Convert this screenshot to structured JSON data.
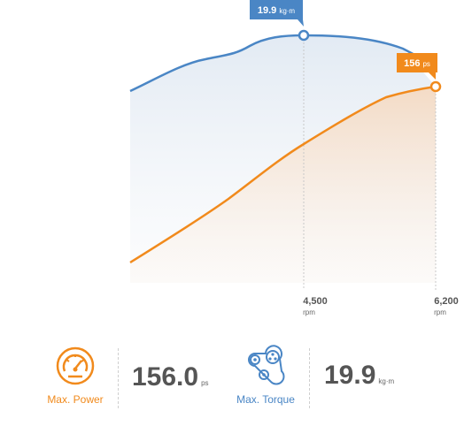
{
  "colors": {
    "power": "#f18a1c",
    "torque": "#4a86c5",
    "text": "#555555"
  },
  "chart_data": {
    "type": "line",
    "x_ticks": [
      {
        "value": "4,500",
        "unit": "rpm"
      },
      {
        "value": "6,200",
        "unit": "rpm"
      }
    ],
    "series": [
      {
        "key": "torque",
        "peak_label_value": "19.9",
        "peak_label_unit": "kg·m",
        "peak_rpm": 4500
      },
      {
        "key": "power",
        "peak_label_value": "156",
        "peak_label_unit": "ps",
        "peak_rpm": 6200
      }
    ]
  },
  "stats": {
    "power": {
      "icon": "speedometer-icon",
      "label": "Max. Power",
      "value": "156.0",
      "unit": "ps"
    },
    "torque": {
      "icon": "engine-belt-icon",
      "label": "Max. Torque",
      "value": "19.9",
      "unit": "kg·m"
    }
  }
}
